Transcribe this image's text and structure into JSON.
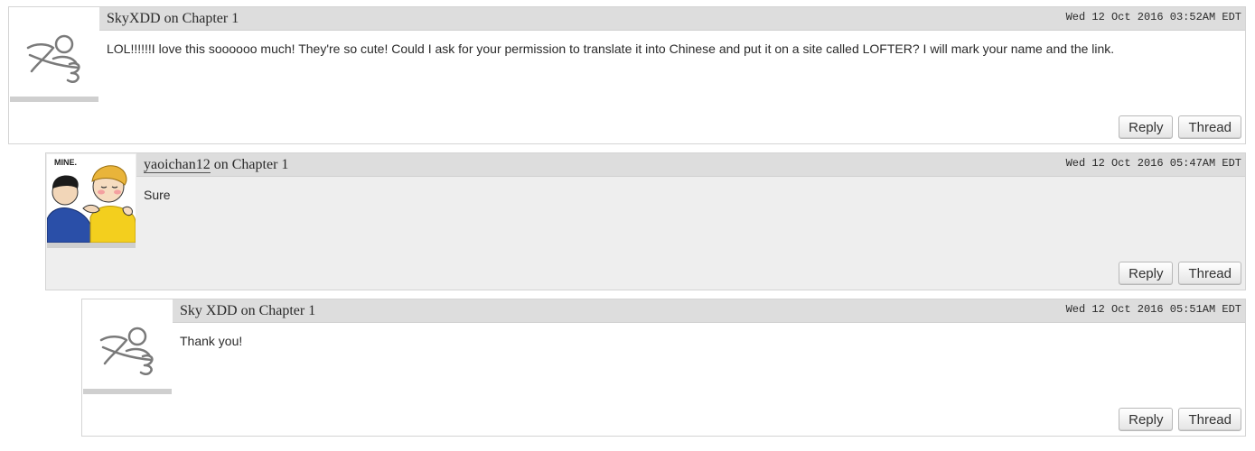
{
  "comments": [
    {
      "username": "SkyXDD",
      "chapter_text": "on Chapter 1",
      "datetime": "Wed 12 Oct 2016 03:52AM EDT",
      "text": "LOL!!!!!!I love this soooooo much! They're so cute! Could I ask for your permission to translate it into Chinese and put it on a site called LOFTER? I will mark your name and the link.",
      "reply_label": "Reply",
      "thread_label": "Thread",
      "avatar_icon": "default-user-icon"
    },
    {
      "username": "yaoichan12",
      "chapter_text": "on Chapter 1",
      "datetime": "Wed 12 Oct 2016 05:47AM EDT",
      "text": "Sure",
      "reply_label": "Reply",
      "thread_label": "Thread",
      "avatar_text": "MINE."
    },
    {
      "username": "Sky XDD",
      "chapter_text": "on Chapter 1",
      "datetime": "Wed 12 Oct 2016 05:51AM EDT",
      "text": "Thank you!",
      "reply_label": "Reply",
      "thread_label": "Thread",
      "avatar_icon": "default-user-icon"
    }
  ],
  "colors": {
    "header_bg": "#dddddd",
    "highlight_bg": "#eeeeee",
    "border": "#d4d4d4"
  }
}
